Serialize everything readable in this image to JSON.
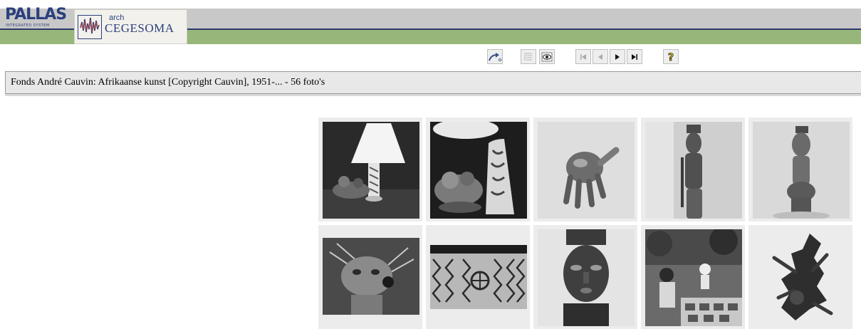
{
  "branding": {
    "pallas_logo_text": "PALLAS",
    "pallas_logo_subtitle": "INTEGRATED SYSTEM",
    "archive_label": "arch",
    "archive_name": "CEGESOMA"
  },
  "toolbar": {
    "buttons": [
      {
        "id": "back",
        "icon": "arrow-curved-icon",
        "enabled": true
      },
      {
        "id": "list-view",
        "icon": "list-icon",
        "enabled": false
      },
      {
        "id": "detail-view",
        "icon": "eye-icon",
        "enabled": true
      },
      {
        "id": "first",
        "icon": "first-page-icon",
        "enabled": false
      },
      {
        "id": "previous",
        "icon": "previous-page-icon",
        "enabled": false
      },
      {
        "id": "next",
        "icon": "next-page-icon",
        "enabled": true
      },
      {
        "id": "last",
        "icon": "last-page-icon",
        "enabled": true
      },
      {
        "id": "help",
        "icon": "help-icon",
        "enabled": true
      }
    ]
  },
  "collection": {
    "title": "Fonds André Cauvin: Afrikaanse kunst [Copyright Cauvin], 1951-... - 56 foto's"
  },
  "thumbnails": [
    {
      "subject": "lamp with carved figure base",
      "orientation": "landscape"
    },
    {
      "subject": "carved lamp and figure close-up",
      "orientation": "landscape"
    },
    {
      "subject": "mask held in hand",
      "orientation": "landscape"
    },
    {
      "subject": "standing carved figure with staff",
      "orientation": "landscape"
    },
    {
      "subject": "carved figure on pedestal",
      "orientation": "landscape"
    },
    {
      "subject": "feathered mask",
      "orientation": "landscape"
    },
    {
      "subject": "carved panel with patterns",
      "orientation": "landscape"
    },
    {
      "subject": "carved face mask",
      "orientation": "portrait"
    },
    {
      "subject": "market scene with craftsmen",
      "orientation": "landscape"
    },
    {
      "subject": "raffia costume figure",
      "orientation": "portrait"
    }
  ],
  "colors": {
    "header_gray": "#c8c8c8",
    "header_green": "#97b77a",
    "header_line": "#2e3b6b",
    "logo_blue": "#2b3f7d",
    "title_bar_bg": "#e8e8e8",
    "thumb_frame": "#ececec"
  }
}
